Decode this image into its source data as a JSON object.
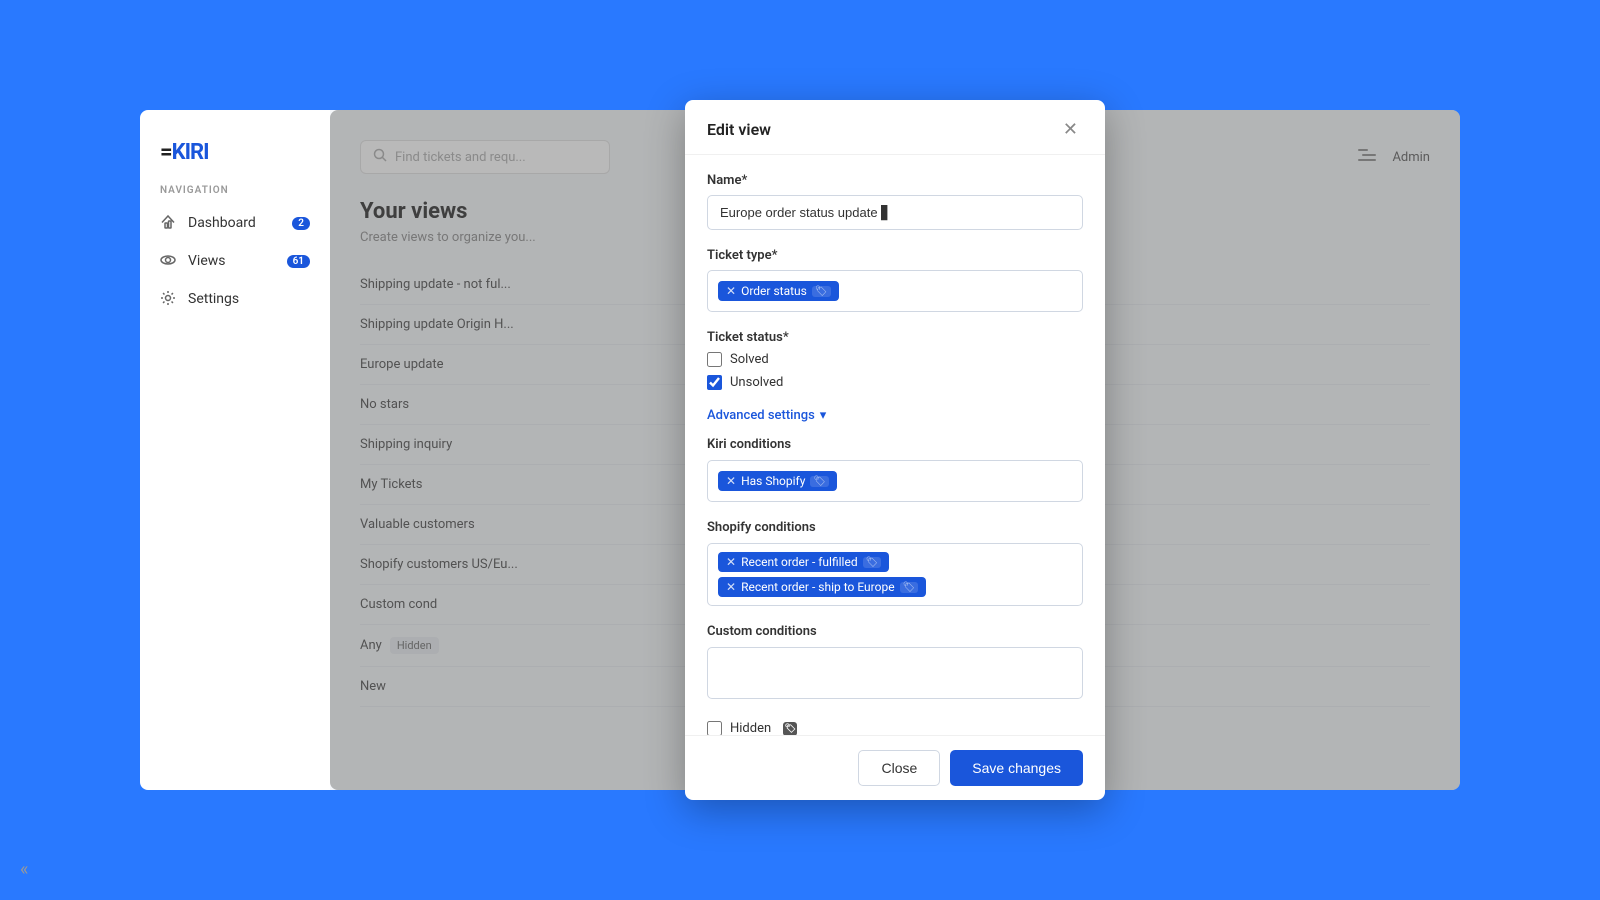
{
  "app": {
    "logo": "=KIRI",
    "logo_colored": "KIRI"
  },
  "sidebar": {
    "nav_label": "NAVIGATION",
    "items": [
      {
        "id": "dashboard",
        "label": "Dashboard",
        "icon": "dashboard-icon",
        "badge": "2"
      },
      {
        "id": "views",
        "label": "Views",
        "icon": "views-icon",
        "badge": "61"
      },
      {
        "id": "settings",
        "label": "Settings",
        "icon": "settings-icon",
        "badge": null
      }
    ],
    "collapse_label": "«"
  },
  "main": {
    "search_placeholder": "Find tickets and requ...",
    "admin_label": "Admin",
    "page_title": "Your views",
    "page_subtitle": "Create views to organize you...",
    "views": [
      {
        "label": "Shipping update - not ful...",
        "hidden": false
      },
      {
        "label": "Shipping update Origin H...",
        "hidden": false
      },
      {
        "label": "Europe update",
        "hidden": false
      },
      {
        "label": "No stars",
        "hidden": false
      },
      {
        "label": "Shipping inquiry",
        "hidden": false
      },
      {
        "label": "My Tickets",
        "hidden": false
      },
      {
        "label": "Valuable customers",
        "hidden": false
      },
      {
        "label": "Shopify customers US/Eu...",
        "hidden": false
      },
      {
        "label": "Custom cond",
        "hidden": false
      },
      {
        "label": "Any",
        "hidden": true
      },
      {
        "label": "New",
        "hidden": false
      }
    ]
  },
  "modal": {
    "title": "Edit view",
    "name_label": "Name*",
    "name_value": "Europe order status update",
    "ticket_type_label": "Ticket type*",
    "ticket_type_tags": [
      {
        "text": "Order status",
        "info": "🏷"
      }
    ],
    "ticket_status_label": "Ticket status*",
    "checkboxes": [
      {
        "id": "solved",
        "label": "Solved",
        "checked": false
      },
      {
        "id": "unsolved",
        "label": "Unsolved",
        "checked": true
      }
    ],
    "advanced_settings_label": "Advanced settings",
    "kiri_conditions_label": "Kiri conditions",
    "kiri_conditions_tags": [
      {
        "text": "Has Shopify",
        "info": "🏷"
      }
    ],
    "shopify_conditions_label": "Shopify conditions",
    "shopify_conditions_tags": [
      {
        "text": "Recent order - fulfilled",
        "info": "🏷"
      },
      {
        "text": "Recent order - ship to Europe",
        "info": "🏷"
      }
    ],
    "custom_conditions_label": "Custom conditions",
    "custom_conditions_value": "",
    "hidden_label": "Hidden",
    "hidden_checked": false,
    "close_label": "Close",
    "save_label": "Save changes",
    "colors": {
      "primary": "#1a56db",
      "tag_bg": "#1a56db"
    }
  }
}
